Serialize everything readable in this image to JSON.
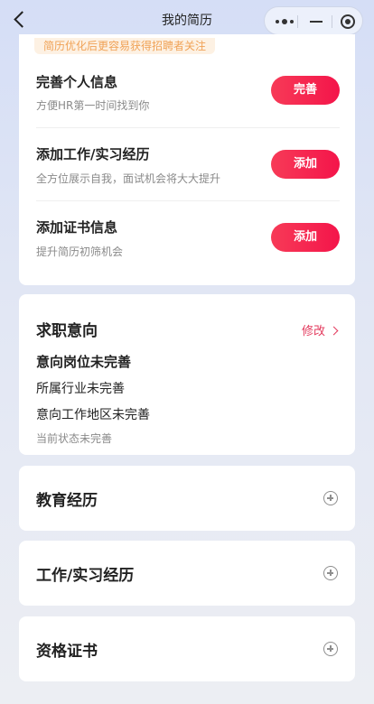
{
  "header": {
    "title": "我的简历"
  },
  "complete_card": {
    "hint": "简历优化后更容易获得招聘者关注",
    "tasks": [
      {
        "title": "完善个人信息",
        "desc": "方便HR第一时间找到你",
        "button": "完善"
      },
      {
        "title": "添加工作/实习经历",
        "desc": "全方位展示自我，面试机会将大大提升",
        "button": "添加"
      },
      {
        "title": "添加证书信息",
        "desc": "提升简历初筛机会",
        "button": "添加"
      }
    ]
  },
  "intent": {
    "title": "求职意向",
    "edit": "修改",
    "position": "意向岗位未完善",
    "industry": "所属行业未完善",
    "region": "意向工作地区未完善",
    "status": "当前状态未完善"
  },
  "sections": [
    {
      "title": "教育经历"
    },
    {
      "title": "工作/实习经历"
    },
    {
      "title": "资格证书"
    }
  ],
  "colors": {
    "accent": "#f4154a",
    "hint_text": "#f0a256",
    "hint_bg": "#fdf1e3"
  }
}
